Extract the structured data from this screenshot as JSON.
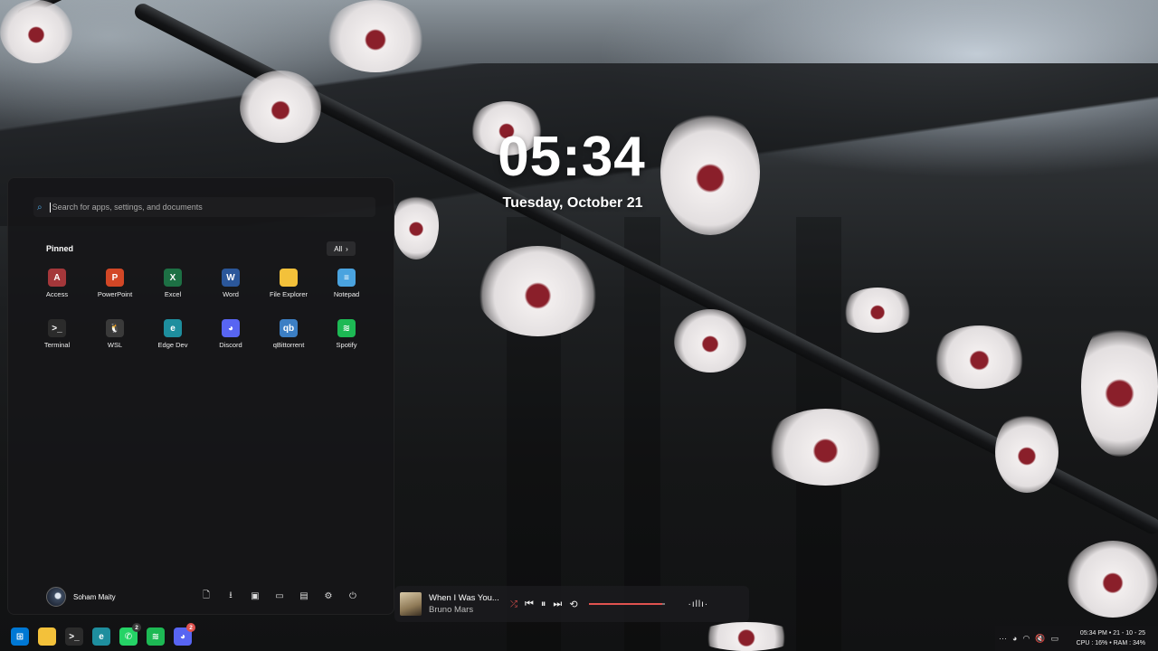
{
  "wallpaper": "cherry-blossom-branch",
  "clock": {
    "time": "05:34",
    "date": "Tuesday, October 21"
  },
  "start_menu": {
    "search_placeholder": "Search for apps, settings, and documents",
    "pinned_label": "Pinned",
    "all_button": "All",
    "apps": [
      {
        "label": "Access",
        "icon": "access-icon",
        "color": "#a4373a",
        "glyph": "A"
      },
      {
        "label": "PowerPoint",
        "icon": "powerpoint-icon",
        "color": "#d24726",
        "glyph": "P"
      },
      {
        "label": "Excel",
        "icon": "excel-icon",
        "color": "#1d7044",
        "glyph": "X"
      },
      {
        "label": "Word",
        "icon": "word-icon",
        "color": "#2b579a",
        "glyph": "W"
      },
      {
        "label": "File Explorer",
        "icon": "folder-icon",
        "color": "#f3c13a",
        "glyph": ""
      },
      {
        "label": "Notepad",
        "icon": "notepad-icon",
        "color": "#4aa3df",
        "glyph": "≡"
      },
      {
        "label": "Terminal",
        "icon": "terminal-icon",
        "color": "#2b2b2b",
        "glyph": ">_"
      },
      {
        "label": "WSL",
        "icon": "penguin-icon",
        "color": "#3a3a3a",
        "glyph": "🐧"
      },
      {
        "label": "Edge Dev",
        "icon": "edge-dev-icon",
        "color": "#1e8e9e",
        "glyph": "e"
      },
      {
        "label": "Discord",
        "icon": "discord-icon",
        "color": "#5865f2",
        "glyph": "◕"
      },
      {
        "label": "qBittorrent",
        "icon": "qbittorrent-icon",
        "color": "#3c7fc4",
        "glyph": "qb"
      },
      {
        "label": "Spotify",
        "icon": "spotify-icon",
        "color": "#1db954",
        "glyph": "≋"
      }
    ],
    "user_name": "Soham Maity",
    "quick_icons": [
      "document-icon",
      "download-icon",
      "pictures-icon",
      "video-icon",
      "folder-icon",
      "settings-icon",
      "power-icon"
    ]
  },
  "media": {
    "title": "When I Was You...",
    "artist": "Bruno Mars",
    "progress": 0.97,
    "accent": "#e0524f"
  },
  "taskbar": {
    "items": [
      {
        "name": "start-button",
        "color": "#0078d4",
        "glyph": "⊞",
        "badge": ""
      },
      {
        "name": "file-explorer-taskbar-icon",
        "color": "#f3c13a",
        "glyph": "",
        "badge": ""
      },
      {
        "name": "terminal-taskbar-icon",
        "color": "#2b2b2b",
        "glyph": ">_",
        "badge": ""
      },
      {
        "name": "edge-dev-taskbar-icon",
        "color": "#1e8e9e",
        "glyph": "e",
        "badge": ""
      },
      {
        "name": "whatsapp-taskbar-icon",
        "color": "#25d366",
        "glyph": "✆",
        "badge": "2"
      },
      {
        "name": "spotify-taskbar-icon",
        "color": "#1db954",
        "glyph": "≋",
        "badge": ""
      },
      {
        "name": "discord-taskbar-icon",
        "color": "#5865f2",
        "glyph": "◕",
        "badge": "2"
      }
    ]
  },
  "tray": {
    "time_date": "05:34 PM • 21 - 10 - 25",
    "stats": "CPU : 16% • RAM : 34%"
  }
}
